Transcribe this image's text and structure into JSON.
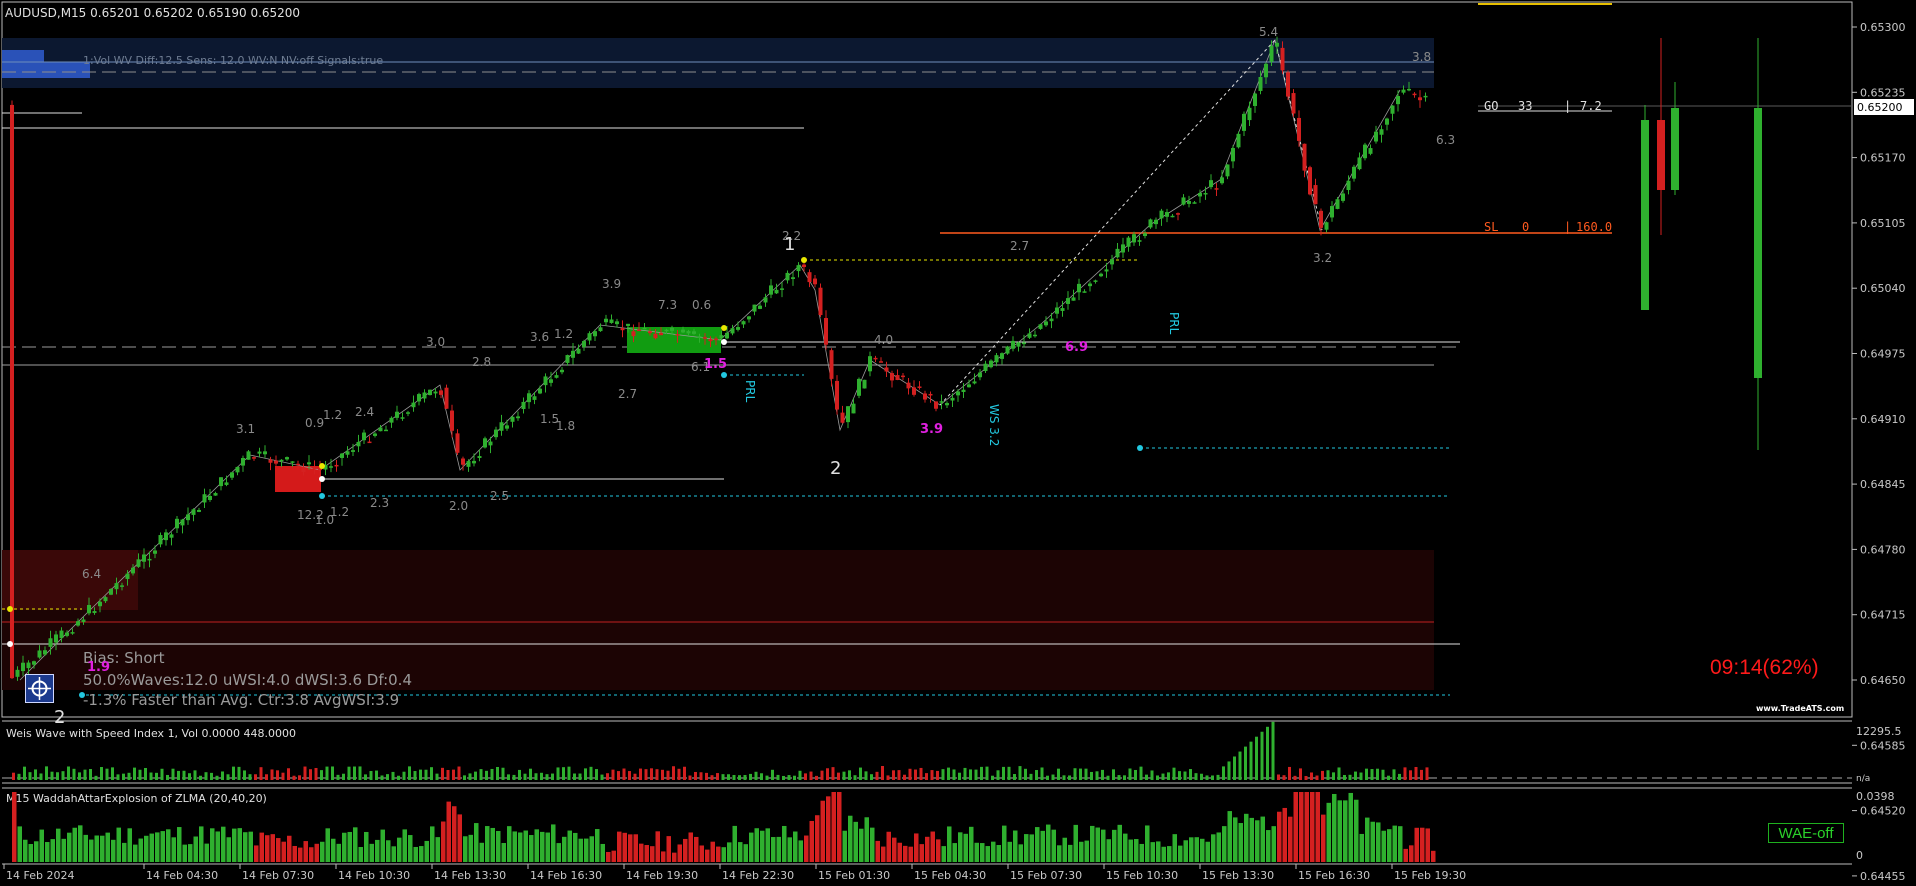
{
  "header": {
    "symbol_title": "AUDUSD,M15  0.65201 0.65202 0.65190 0.65200",
    "vol_info": "1:Vol   WV Diff:12.5 Sens: 12.0 WV:N NV:off Signals:true"
  },
  "price_axis": {
    "ticks": [
      "0.65300",
      "0.65235",
      "0.65170",
      "0.65105",
      "0.65040",
      "0.64975",
      "0.64910",
      "0.64845",
      "0.64780",
      "0.64715",
      "0.64650",
      "0.64585",
      "0.64520",
      "0.64455"
    ],
    "current": "0.65200"
  },
  "time_axis": [
    "14 Feb 2024",
    "14 Feb 04:30",
    "14 Feb 07:30",
    "14 Feb 10:30",
    "14 Feb 13:30",
    "14 Feb 16:30",
    "14 Feb 19:30",
    "14 Feb 22:30",
    "15 Feb 01:30",
    "15 Feb 04:30",
    "15 Feb 07:30",
    "15 Feb 10:30",
    "15 Feb 13:30",
    "15 Feb 16:30",
    "15 Feb 19:30"
  ],
  "trade_panel": {
    "go": {
      "label": "GO",
      "value": "33",
      "ratio": "7.2"
    },
    "sl": {
      "label": "SL",
      "value": "0",
      "ratio": "160.0"
    }
  },
  "bias": {
    "line1": "Bias: Short",
    "line2": "50.0%Waves:12.0 uWSI:4.0 dWSI:3.6 Df:0.4",
    "line3": "-1.3% Faster than Avg. Ctr:3.8 AvgWSI:3.9"
  },
  "annotations": {
    "wave_labels": [
      "3.1",
      "0.9",
      "1.2",
      "2.4",
      "3.0",
      "2.8",
      "3.6",
      "1.2",
      "3.9",
      "7.3",
      "0.6",
      "2.2",
      "4.0",
      "2.7",
      "5.4",
      "3.8",
      "6.3",
      "3.2",
      "1.5",
      "1.8",
      "2.7",
      "6.1",
      "2.3",
      "2.0",
      "2.5",
      "12.2",
      "1.0",
      "1.2",
      "6.4"
    ],
    "magenta_labels": [
      "1.5",
      "3.9",
      "6.9",
      "1.9"
    ],
    "swing_labels": [
      "1",
      "2",
      "2"
    ],
    "prl_labels": [
      "PRL",
      "PRL"
    ],
    "ws_label": "WS 3.2"
  },
  "timer": "09:14(62%)",
  "brand": "www.TradeATS.com",
  "indicator1": {
    "title": "Weis Wave with Speed Index 1, Vol   0.0000 448.0000",
    "axis_top": "12295.5",
    "axis_bottom": "n/a"
  },
  "indicator2": {
    "title": "M15 WaddahAttarExplosion of ZLMA (20,40,20)",
    "axis_top": "0.0398",
    "axis_bottom": "0",
    "badge": "WAE-off"
  },
  "colors": {
    "bull": "#2fb02f",
    "bear": "#d42020",
    "bg": "#000000",
    "accent_cyan": "#22c8e0",
    "magenta": "#e020e0",
    "orange": "#ff5a1f"
  }
}
